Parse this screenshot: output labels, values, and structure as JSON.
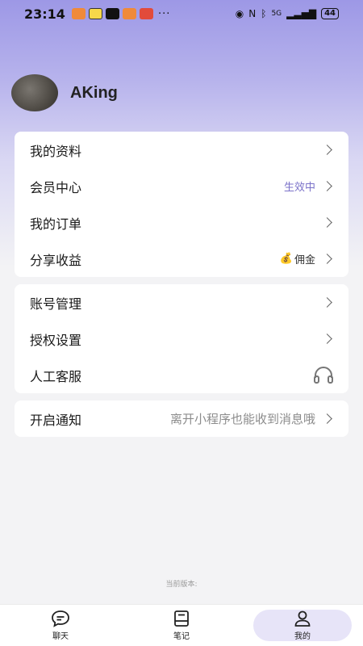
{
  "status_bar": {
    "time": "23:14",
    "dots": "···",
    "network": "5G",
    "battery": "44"
  },
  "profile": {
    "username": "AKing"
  },
  "menu_group_1": [
    {
      "label": "我的资料",
      "extra": ""
    },
    {
      "label": "会员中心",
      "extra": "生效中"
    },
    {
      "label": "我的订单",
      "extra": ""
    },
    {
      "label": "分享收益",
      "extra": "佣金",
      "icon": "money-bag-icon"
    }
  ],
  "menu_group_2": [
    {
      "label": "账号管理"
    },
    {
      "label": "授权设置"
    },
    {
      "label": "人工客服",
      "icon": "headset-icon"
    }
  ],
  "notify": {
    "label": "开启通知",
    "hint": "离开小程序也能收到消息哦"
  },
  "version_label": "当前版本:",
  "tabbar": {
    "tabs": [
      {
        "label": "聊天",
        "icon": "chat-icon"
      },
      {
        "label": "笔记",
        "icon": "notebook-icon"
      },
      {
        "label": "我的",
        "icon": "person-icon",
        "active": true
      }
    ]
  },
  "colors": {
    "accent": "#7b72c9",
    "header_gradient_top": "#9d98e6",
    "background": "#f3f3f5"
  }
}
